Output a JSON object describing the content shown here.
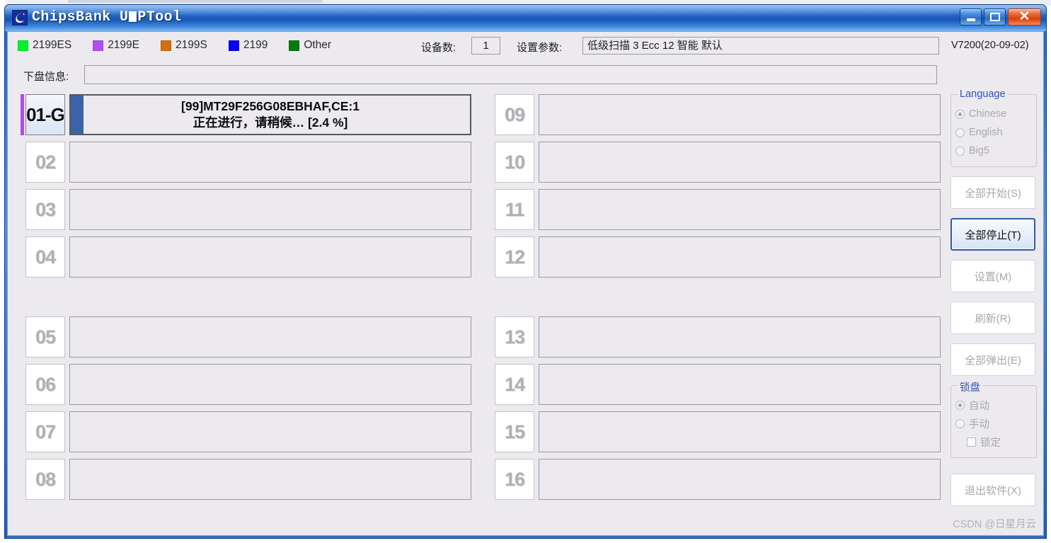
{
  "window": {
    "title_prefix": "ChipsBank U",
    "title_suffix": "PTool",
    "icon": "chipsbank-logo-icon",
    "minimize_label": "",
    "maximize_label": "",
    "close_label": "✕"
  },
  "legend": [
    {
      "label": "2199ES",
      "color": "#00f52b"
    },
    {
      "label": "2199E",
      "color": "#b44ef0"
    },
    {
      "label": "2199S",
      "color": "#d2700a"
    },
    {
      "label": "2199",
      "color": "#0a00f5"
    },
    {
      "label": "Other",
      "color": "#067a0a"
    }
  ],
  "toolbar": {
    "device_count_label": "设备数:",
    "device_count_value": "1",
    "params_label": "设置参数:",
    "params_value": "低级扫描 3 Ecc 12 智能 默认",
    "version": "V7200(20-09-02)"
  },
  "disk_info": {
    "label": "下盘信息:",
    "value": ""
  },
  "slots": [
    {
      "id": "01-G",
      "enabled": true,
      "stripe": "#b14ae8",
      "progress_pct": 2.4,
      "line1": "[99]MT29F256G08EBHAF,CE:1",
      "line2": "正在进行，请稍候… [2.4 %]"
    },
    {
      "id": "02",
      "enabled": false,
      "stripe": "",
      "progress_pct": 0,
      "line1": "",
      "line2": ""
    },
    {
      "id": "03",
      "enabled": false,
      "stripe": "",
      "progress_pct": 0,
      "line1": "",
      "line2": ""
    },
    {
      "id": "04",
      "enabled": false,
      "stripe": "",
      "progress_pct": 0,
      "line1": "",
      "line2": ""
    },
    {
      "id": "05",
      "enabled": false,
      "stripe": "",
      "progress_pct": 0,
      "line1": "",
      "line2": ""
    },
    {
      "id": "06",
      "enabled": false,
      "stripe": "",
      "progress_pct": 0,
      "line1": "",
      "line2": ""
    },
    {
      "id": "07",
      "enabled": false,
      "stripe": "",
      "progress_pct": 0,
      "line1": "",
      "line2": ""
    },
    {
      "id": "08",
      "enabled": false,
      "stripe": "",
      "progress_pct": 0,
      "line1": "",
      "line2": ""
    },
    {
      "id": "09",
      "enabled": false,
      "stripe": "",
      "progress_pct": 0,
      "line1": "",
      "line2": ""
    },
    {
      "id": "10",
      "enabled": false,
      "stripe": "",
      "progress_pct": 0,
      "line1": "",
      "line2": ""
    },
    {
      "id": "11",
      "enabled": false,
      "stripe": "",
      "progress_pct": 0,
      "line1": "",
      "line2": ""
    },
    {
      "id": "12",
      "enabled": false,
      "stripe": "",
      "progress_pct": 0,
      "line1": "",
      "line2": ""
    },
    {
      "id": "13",
      "enabled": false,
      "stripe": "",
      "progress_pct": 0,
      "line1": "",
      "line2": ""
    },
    {
      "id": "14",
      "enabled": false,
      "stripe": "",
      "progress_pct": 0,
      "line1": "",
      "line2": ""
    },
    {
      "id": "15",
      "enabled": false,
      "stripe": "",
      "progress_pct": 0,
      "line1": "",
      "line2": ""
    },
    {
      "id": "16",
      "enabled": false,
      "stripe": "",
      "progress_pct": 0,
      "line1": "",
      "line2": ""
    }
  ],
  "sidebar": {
    "language_group": {
      "title": "Language",
      "options": [
        {
          "label": "Chinese",
          "selected": true
        },
        {
          "label": "English",
          "selected": false
        },
        {
          "label": "Big5",
          "selected": false
        }
      ]
    },
    "buttons": [
      {
        "label": "全部开始(S)",
        "active": false,
        "name": "start-all-button"
      },
      {
        "label": "全部停止(T)",
        "active": true,
        "name": "stop-all-button"
      },
      {
        "label": "设置(M)",
        "active": false,
        "name": "settings-button"
      },
      {
        "label": "刷新(R)",
        "active": false,
        "name": "refresh-button"
      },
      {
        "label": "全部弹出(E)",
        "active": false,
        "name": "eject-all-button"
      }
    ],
    "lock_group": {
      "title": "锁盘",
      "options": [
        {
          "label": "自动",
          "selected": true
        },
        {
          "label": "手动",
          "selected": false
        }
      ],
      "checkbox": {
        "label": "锁定",
        "checked": false
      }
    },
    "exit_button": {
      "label": "退出软件(X)",
      "active": false
    }
  },
  "watermark": "CSDN @日星月云"
}
